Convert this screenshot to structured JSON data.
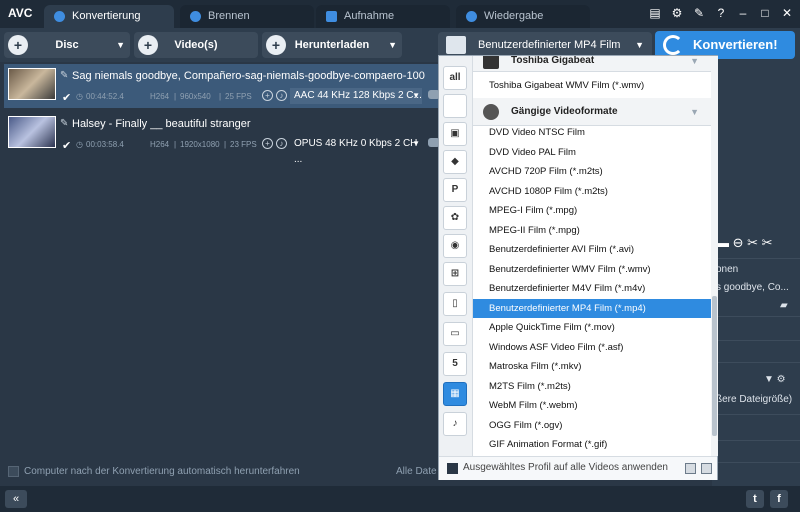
{
  "app": {
    "logo": "AVC"
  },
  "tabs": [
    {
      "label": "Konvertierung"
    },
    {
      "label": "Brennen"
    },
    {
      "label": "Aufnahme"
    },
    {
      "label": "Wiedergabe"
    }
  ],
  "toolbar": {
    "disc_label": "Disc",
    "videos_label": "Video(s)",
    "download_label": "Herunterladen",
    "profile_value": "Benutzerdefinierter MP4 Film (*.mp4)",
    "convert_label": "Konvertieren!"
  },
  "files": [
    {
      "name": "Sag niemals goodbye, Compañero-sag-niemals-goodbye-compaero-100",
      "duration": "00:44:52.4",
      "codec": "H264",
      "resolution": "960x540",
      "fps": "25 FPS",
      "audio": "AAC 44 KHz 128 Kbps 2 C..."
    },
    {
      "name": "Halsey - Finally __ beautiful stranger",
      "duration": "00:03:58.4",
      "codec": "H264",
      "resolution": "1920x1080",
      "fps": "23 FPS",
      "audio": "OPUS 48 KHz 0 Kbps 2 CH ..."
    }
  ],
  "footer": {
    "shutdown_label": "Computer nach der Konvertierung automatisch herunterfahren",
    "alle_label": "Alle Date"
  },
  "right_panel": {
    "onen_label": "onen",
    "title_partial": "s goodbye, Co...",
    "size_partial": "ßere Dateigröße)"
  },
  "dropdown": {
    "categories": [
      "all",
      "apple",
      "android-alt",
      "android",
      "playstation",
      "huawei",
      "lg",
      "windows",
      "phone",
      "tv",
      "html5",
      "film",
      "music"
    ],
    "group_toshiba": "Toshiba Gigabeat",
    "toshiba_item": "Toshiba Gigabeat WMV Film (*.wmv)",
    "group_common": "Gängige Videoformate",
    "formats": [
      "DVD Video NTSC Film",
      "DVD Video PAL Film",
      "AVCHD 720P Film (*.m2ts)",
      "AVCHD 1080P Film (*.m2ts)",
      "MPEG-I Film (*.mpg)",
      "MPEG-II Film (*.mpg)",
      "Benutzerdefinierter AVI Film (*.avi)",
      "Benutzerdefinierter WMV Film (*.wmv)",
      "Benutzerdefinierter M4V Film (*.m4v)",
      "Benutzerdefinierter MP4 Film (*.mp4)",
      "Apple QuickTime Film (*.mov)",
      "Windows ASF Video Film (*.asf)",
      "Matroska Film (*.mkv)",
      "M2TS Film (*.m2ts)",
      "WebM Film (*.webm)",
      "OGG Film (*.ogv)",
      "GIF Animation Format (*.gif)"
    ],
    "apply_label": "Ausgewähltes Profil auf alle Videos anwenden"
  },
  "colors": {
    "accent": "#2f8be0",
    "bg": "#2a3746"
  }
}
